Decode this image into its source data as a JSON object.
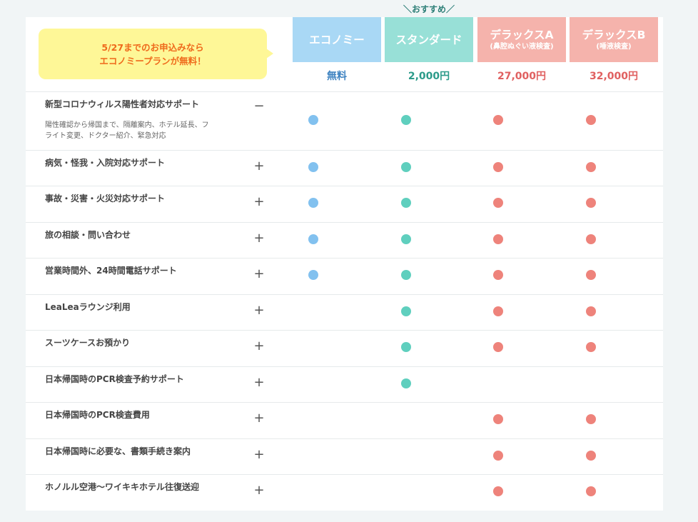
{
  "callout": {
    "line1": "5/27までのお申込みなら",
    "line2": "エコノミープランが無料！",
    "color": "#ef6a1c",
    "bg": "#fef797"
  },
  "recommend_label": "＼おすすめ／",
  "plans": [
    {
      "key": "eco",
      "name": "エコノミー",
      "sub": "",
      "price": "無料",
      "color": "#a9d8f5"
    },
    {
      "key": "std",
      "name": "スタンダード",
      "sub": "",
      "price": "2,000円",
      "color": "#98e0d7"
    },
    {
      "key": "dxa",
      "name": "デラックスA",
      "sub": "(鼻腔ぬぐい液検査)",
      "price": "27,000円",
      "color": "#f5b3ac"
    },
    {
      "key": "dxb",
      "name": "デラックスB",
      "sub": "(唾液検査)",
      "price": "32,000円",
      "color": "#f5b3ac"
    }
  ],
  "rows": [
    {
      "label": "新型コロナウィルス陽性者対応サポート",
      "desc": "陽性確認から帰国まで、隔離案内、ホテル延長、フライト変更、ドクター紹介、緊急対応",
      "toggle": "−",
      "eco": true,
      "std": true,
      "dxa": true,
      "dxb": true
    },
    {
      "label": "病気・怪我・入院対応サポート",
      "desc": "",
      "toggle": "+",
      "eco": true,
      "std": true,
      "dxa": true,
      "dxb": true
    },
    {
      "label": "事故・災害・火災対応サポート",
      "desc": "",
      "toggle": "+",
      "eco": true,
      "std": true,
      "dxa": true,
      "dxb": true
    },
    {
      "label": "旅の相談・問い合わせ",
      "desc": "",
      "toggle": "+",
      "eco": true,
      "std": true,
      "dxa": true,
      "dxb": true
    },
    {
      "label": "営業時間外、24時間電話サポート",
      "desc": "",
      "toggle": "+",
      "eco": true,
      "std": true,
      "dxa": true,
      "dxb": true
    },
    {
      "label": "LeaLeaラウンジ利用",
      "desc": "",
      "toggle": "+",
      "eco": false,
      "std": true,
      "dxa": true,
      "dxb": true
    },
    {
      "label": "スーツケースお預かり",
      "desc": "",
      "toggle": "+",
      "eco": false,
      "std": true,
      "dxa": true,
      "dxb": true
    },
    {
      "label": "日本帰国時のPCR検査予約サポート",
      "desc": "",
      "toggle": "+",
      "eco": false,
      "std": true,
      "dxa": false,
      "dxb": false
    },
    {
      "label": "日本帰国時のPCR検査費用",
      "desc": "",
      "toggle": "+",
      "eco": false,
      "std": false,
      "dxa": true,
      "dxb": true
    },
    {
      "label": "日本帰国時に必要な、書類手続き案内",
      "desc": "",
      "toggle": "+",
      "eco": false,
      "std": false,
      "dxa": true,
      "dxb": true
    },
    {
      "label": "ホノルル空港〜ワイキキホテル往復送迎",
      "desc": "",
      "toggle": "+",
      "eco": false,
      "std": false,
      "dxa": true,
      "dxb": true
    }
  ],
  "dot_colors": {
    "eco": "#82c1ef",
    "std": "#5fcfbe",
    "dxa": "#ee837b",
    "dxb": "#ee837b"
  }
}
